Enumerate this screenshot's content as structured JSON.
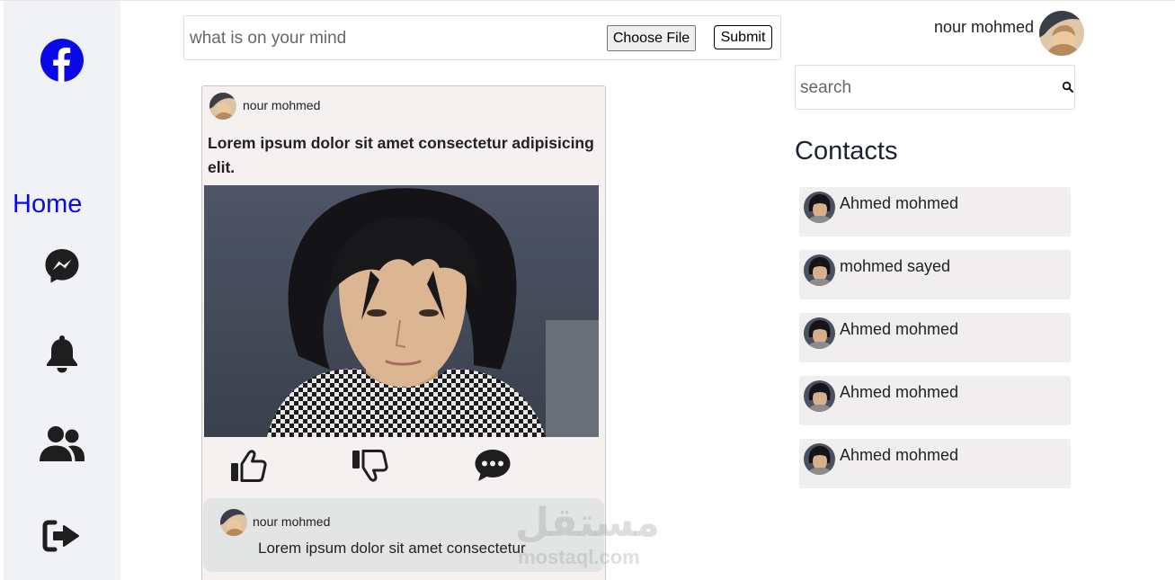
{
  "sidebar": {
    "logo_icon": "facebook-icon",
    "home_label": "Home",
    "items": [
      {
        "icon": "messenger-icon"
      },
      {
        "icon": "bell-icon"
      },
      {
        "icon": "users-icon"
      },
      {
        "icon": "logout-icon"
      }
    ],
    "accent_color": "#0a0ae6"
  },
  "composer": {
    "placeholder": "what is on your mind",
    "file_label": "Choose File",
    "submit_label": "Submit"
  },
  "post": {
    "author": "nour mohmed",
    "text": "Lorem ipsum dolor sit amet consectetur adipisicing elit.",
    "actions": [
      "thumbs-up-icon",
      "thumbs-down-icon",
      "comment-icon"
    ],
    "comment": {
      "author": "nour mohmed",
      "text": "Lorem ipsum dolor sit amet consectetur"
    }
  },
  "header": {
    "user_name": "nour mohmed"
  },
  "search": {
    "placeholder": "search"
  },
  "contacts": {
    "title": "Contacts",
    "items": [
      {
        "name": "Ahmed mohmed"
      },
      {
        "name": "mohmed sayed"
      },
      {
        "name": "Ahmed mohmed"
      },
      {
        "name": "Ahmed mohmed"
      },
      {
        "name": "Ahmed mohmed"
      }
    ]
  },
  "watermark": {
    "arabic": "مستقل",
    "latin": "mostaql.com"
  }
}
